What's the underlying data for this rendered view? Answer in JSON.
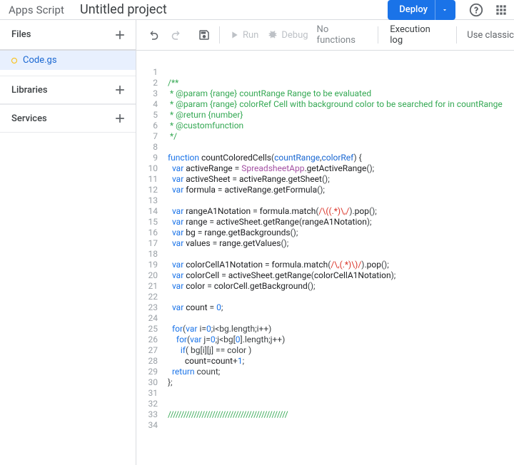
{
  "header": {
    "app_name": "Apps Script",
    "project_title": "Untitled project",
    "deploy_label": "Deploy",
    "use_classic": "Use classic"
  },
  "toolbar": {
    "run_label": "Run",
    "debug_label": "Debug",
    "no_functions": "No functions",
    "exec_log": "Execution log"
  },
  "sidebar": {
    "files_label": "Files",
    "libraries_label": "Libraries",
    "services_label": "Services",
    "file_name": "Code.gs"
  },
  "code": {
    "lines": [
      "",
      {
        "type": "comment",
        "text": "/**"
      },
      {
        "type": "comment",
        "text": " * @param {range} countRange Range to be evaluated"
      },
      {
        "type": "comment",
        "text": " * @param {range} colorRef Cell with background color to be searched for in countRange"
      },
      {
        "type": "comment",
        "text": " * @return {number}"
      },
      {
        "type": "comment",
        "text": " * @customfunction"
      },
      {
        "type": "comment",
        "text": " */"
      },
      "",
      {
        "type": "fn",
        "kw": "function",
        "name": "countColoredCells",
        "params": [
          "countRange",
          "colorRef"
        ]
      },
      {
        "type": "decl",
        "indent": 1,
        "kw": "var",
        "name": "activeRange",
        "rhs": [
          {
            "t": "obj",
            "v": "SpreadsheetApp"
          },
          {
            "t": "p",
            "v": "."
          },
          {
            "t": "call",
            "v": "getActiveRange"
          },
          {
            "t": "p",
            "v": "();"
          }
        ]
      },
      {
        "type": "decl",
        "indent": 1,
        "kw": "var",
        "name": "activeSheet",
        "rhs": [
          {
            "t": "id",
            "v": "activeRange"
          },
          {
            "t": "p",
            "v": "."
          },
          {
            "t": "call",
            "v": "getSheet"
          },
          {
            "t": "p",
            "v": "();"
          }
        ]
      },
      {
        "type": "decl",
        "indent": 1,
        "kw": "var",
        "name": "formula",
        "rhs": [
          {
            "t": "id",
            "v": "activeRange"
          },
          {
            "t": "p",
            "v": "."
          },
          {
            "t": "call",
            "v": "getFormula"
          },
          {
            "t": "p",
            "v": "();"
          }
        ]
      },
      "",
      {
        "type": "decl",
        "indent": 1,
        "kw": "var",
        "name": "rangeA1Notation",
        "rhs": [
          {
            "t": "id",
            "v": "formula"
          },
          {
            "t": "p",
            "v": "."
          },
          {
            "t": "call",
            "v": "match"
          },
          {
            "t": "p",
            "v": "("
          },
          {
            "t": "reg",
            "v": "/\\((.*)\\,/"
          },
          {
            "t": "p",
            "v": ")."
          },
          {
            "t": "call",
            "v": "pop"
          },
          {
            "t": "p",
            "v": "();"
          }
        ]
      },
      {
        "type": "decl",
        "indent": 1,
        "kw": "var",
        "name": "range",
        "rhs": [
          {
            "t": "id",
            "v": "activeSheet"
          },
          {
            "t": "p",
            "v": "."
          },
          {
            "t": "call",
            "v": "getRange"
          },
          {
            "t": "p",
            "v": "("
          },
          {
            "t": "id",
            "v": "rangeA1Notation"
          },
          {
            "t": "p",
            "v": ");"
          }
        ]
      },
      {
        "type": "decl",
        "indent": 1,
        "kw": "var",
        "name": "bg",
        "rhs": [
          {
            "t": "id",
            "v": "range"
          },
          {
            "t": "p",
            "v": "."
          },
          {
            "t": "call",
            "v": "getBackgrounds"
          },
          {
            "t": "p",
            "v": "();"
          }
        ]
      },
      {
        "type": "decl",
        "indent": 1,
        "kw": "var",
        "name": "values",
        "rhs": [
          {
            "t": "id",
            "v": "range"
          },
          {
            "t": "p",
            "v": "."
          },
          {
            "t": "call",
            "v": "getValues"
          },
          {
            "t": "p",
            "v": "();"
          }
        ]
      },
      "",
      {
        "type": "decl",
        "indent": 1,
        "kw": "var",
        "name": "colorCellA1Notation",
        "rhs": [
          {
            "t": "id",
            "v": "formula"
          },
          {
            "t": "p",
            "v": "."
          },
          {
            "t": "call",
            "v": "match"
          },
          {
            "t": "p",
            "v": "("
          },
          {
            "t": "reg",
            "v": "/\\,(.*)\\)/"
          },
          {
            "t": "p",
            "v": ")."
          },
          {
            "t": "call",
            "v": "pop"
          },
          {
            "t": "p",
            "v": "();"
          }
        ]
      },
      {
        "type": "decl",
        "indent": 1,
        "kw": "var",
        "name": "colorCell",
        "rhs": [
          {
            "t": "id",
            "v": "activeSheet"
          },
          {
            "t": "p",
            "v": "."
          },
          {
            "t": "call",
            "v": "getRange"
          },
          {
            "t": "p",
            "v": "("
          },
          {
            "t": "id",
            "v": "colorCellA1Notation"
          },
          {
            "t": "p",
            "v": ");"
          }
        ]
      },
      {
        "type": "decl",
        "indent": 1,
        "kw": "var",
        "name": "color",
        "rhs": [
          {
            "t": "id",
            "v": "colorCell"
          },
          {
            "t": "p",
            "v": "."
          },
          {
            "t": "call",
            "v": "getBackground"
          },
          {
            "t": "p",
            "v": "();"
          }
        ]
      },
      "",
      {
        "type": "decl",
        "indent": 1,
        "kw": "var",
        "name": "count",
        "rhs": [
          {
            "t": "num",
            "v": "0"
          },
          {
            "t": "p",
            "v": ";"
          }
        ]
      },
      "",
      {
        "type": "for",
        "indent": 1,
        "var": "i",
        "start": "0",
        "cond": "i<bg.length",
        "inc": "i++"
      },
      {
        "type": "for",
        "indent": 2,
        "var": "j",
        "start": "0",
        "cond": "j<bg[",
        "idx": "0",
        "cond2": "].length",
        "inc": "j++"
      },
      {
        "type": "if",
        "indent": 3,
        "cond": "bg[i][j] == color"
      },
      {
        "type": "stmt",
        "indent": 4,
        "tokens": [
          {
            "t": "id",
            "v": "count"
          },
          {
            "t": "p",
            "v": "="
          },
          {
            "t": "id",
            "v": "count"
          },
          {
            "t": "p",
            "v": "+"
          },
          {
            "t": "num",
            "v": "1"
          },
          {
            "t": "p",
            "v": ";"
          }
        ]
      },
      {
        "type": "ret",
        "indent": 1,
        "val": "count"
      },
      {
        "type": "raw",
        "text": "};"
      },
      "",
      "",
      {
        "type": "comment",
        "text": "//////////////////////////////////////////////"
      },
      ""
    ]
  }
}
